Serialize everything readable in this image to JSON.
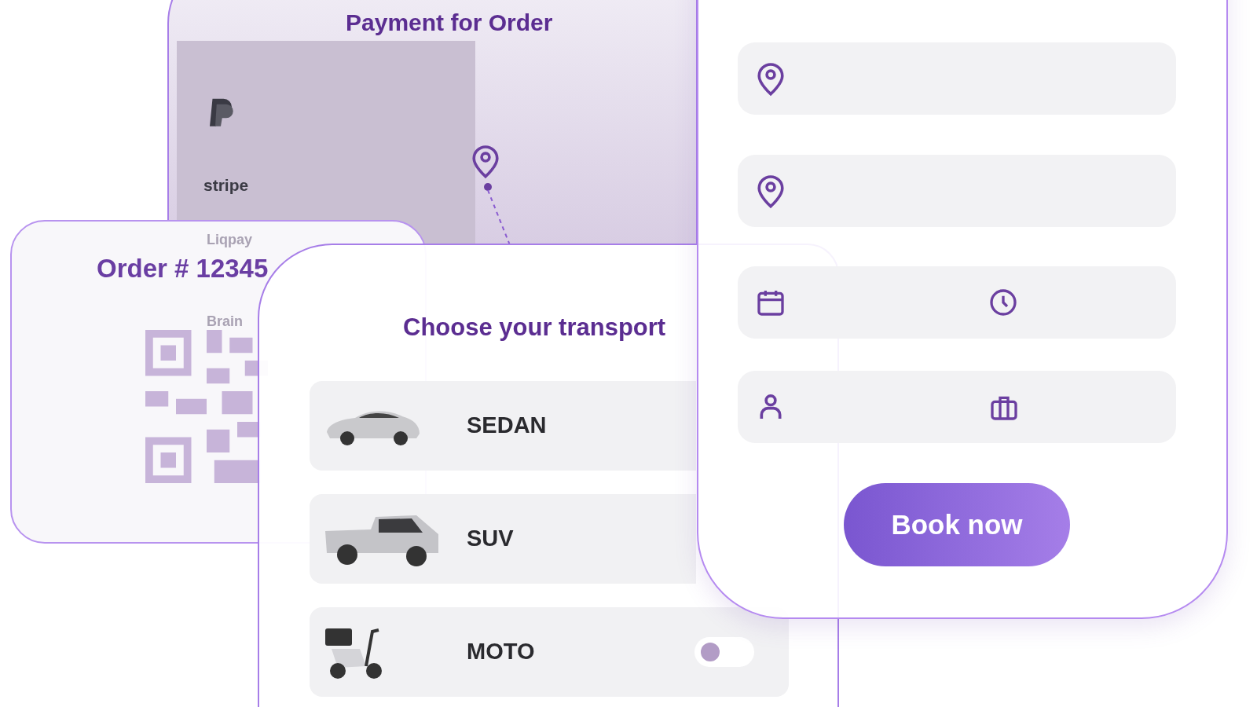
{
  "payment_card": {
    "title": "Payment for Order",
    "providers": [
      "stripe"
    ],
    "faded_providers": [
      "Liqpay",
      "Brain"
    ]
  },
  "order_card": {
    "title": "Order # 12345"
  },
  "transport_card": {
    "title": "Choose your transport",
    "options": [
      {
        "kind": "car",
        "label": "SEDAN"
      },
      {
        "kind": "pickup",
        "label": "SUV"
      },
      {
        "kind": "scooter",
        "label": "MOTO",
        "toggle": {
          "on": false
        }
      }
    ]
  },
  "booking_card": {
    "fields": [
      {
        "icons": [
          {
            "kind": "location"
          }
        ]
      },
      {
        "icons": [
          {
            "kind": "location"
          }
        ]
      },
      {
        "icons": [
          {
            "kind": "date"
          },
          {
            "kind": "time"
          }
        ]
      },
      {
        "icons": [
          {
            "kind": "person"
          },
          {
            "kind": "luggage"
          }
        ]
      }
    ],
    "button": "Book now"
  }
}
